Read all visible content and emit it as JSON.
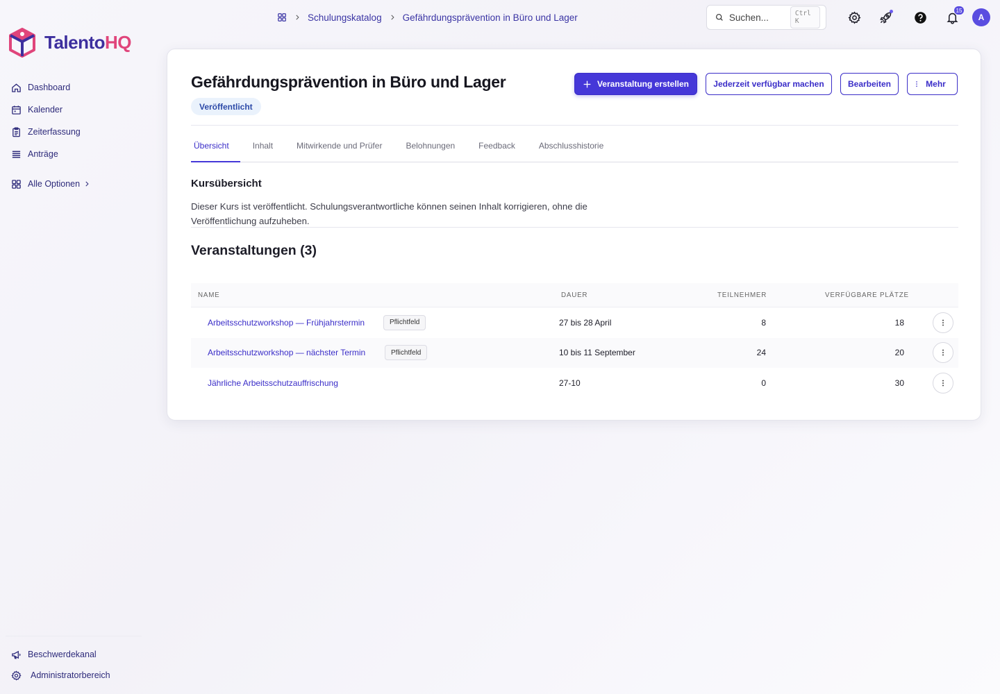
{
  "brand": {
    "part1": "Talento",
    "part2": "HQ"
  },
  "sidebar": {
    "items": [
      {
        "label": "Dashboard",
        "icon": "home-icon"
      },
      {
        "label": "Kalender",
        "icon": "calendar-icon"
      },
      {
        "label": "Zeiterfassung",
        "icon": "clipboard-icon"
      },
      {
        "label": "Anträge",
        "icon": "list-icon"
      }
    ],
    "all_options": "Alle Optionen",
    "bottom": [
      {
        "label": "Beschwerdekanal",
        "icon": "megaphone-icon"
      },
      {
        "label": "Administratorbereich",
        "icon": "gear-icon"
      }
    ]
  },
  "breadcrumb": {
    "items": [
      "Schulungskatalog",
      "Gefährdungsprävention in Büro und Lager"
    ]
  },
  "search": {
    "placeholder": "Suchen...",
    "shortcut": "Ctrl K"
  },
  "notifications": {
    "count": "15"
  },
  "user": {
    "initial": "A"
  },
  "page": {
    "title": "Gefährdungsprävention in Büro und Lager",
    "status": "Veröffentlicht",
    "actions": {
      "create": "Veranstaltung erstellen",
      "available": "Jederzeit verfügbar machen",
      "edit": "Bearbeiten",
      "more": "Mehr"
    },
    "tabs": [
      "Übersicht",
      "Inhalt",
      "Mitwirkende und Prüfer",
      "Belohnungen",
      "Feedback",
      "Abschlusshistorie"
    ],
    "overview": {
      "title": "Kursübersicht",
      "text": "Dieser Kurs ist veröffentlicht. Schulungsverantwortliche können seinen Inhalt korrigieren, ohne die Veröffentlichung aufzuheben."
    },
    "events": {
      "title": "Veranstaltungen (3)",
      "columns": {
        "name": "Name",
        "duration": "Dauer",
        "participants": "Teilnehmer",
        "seats": "Verfügbare Plätze"
      },
      "rows": [
        {
          "name": "Arbeitsschutzworkshop — Frühjahrstermin",
          "tag": "Pflichtfeld",
          "duration": "27 bis 28 April",
          "participants": "8",
          "seats": "18"
        },
        {
          "name": "Arbeitsschutzworkshop — nächster Termin",
          "tag": "Pflichtfeld",
          "duration": "10 bis 11 September",
          "participants": "24",
          "seats": "20"
        },
        {
          "name": "Jährliche Arbeitsschutzauffrischung",
          "tag": "",
          "duration": "27-10",
          "participants": "0",
          "seats": "30"
        }
      ]
    }
  },
  "colors": {
    "primary": "#4537d8",
    "brand_dark": "#3d2f9e",
    "brand_pink": "#e0457b",
    "status_bg": "#eaf2fc"
  }
}
